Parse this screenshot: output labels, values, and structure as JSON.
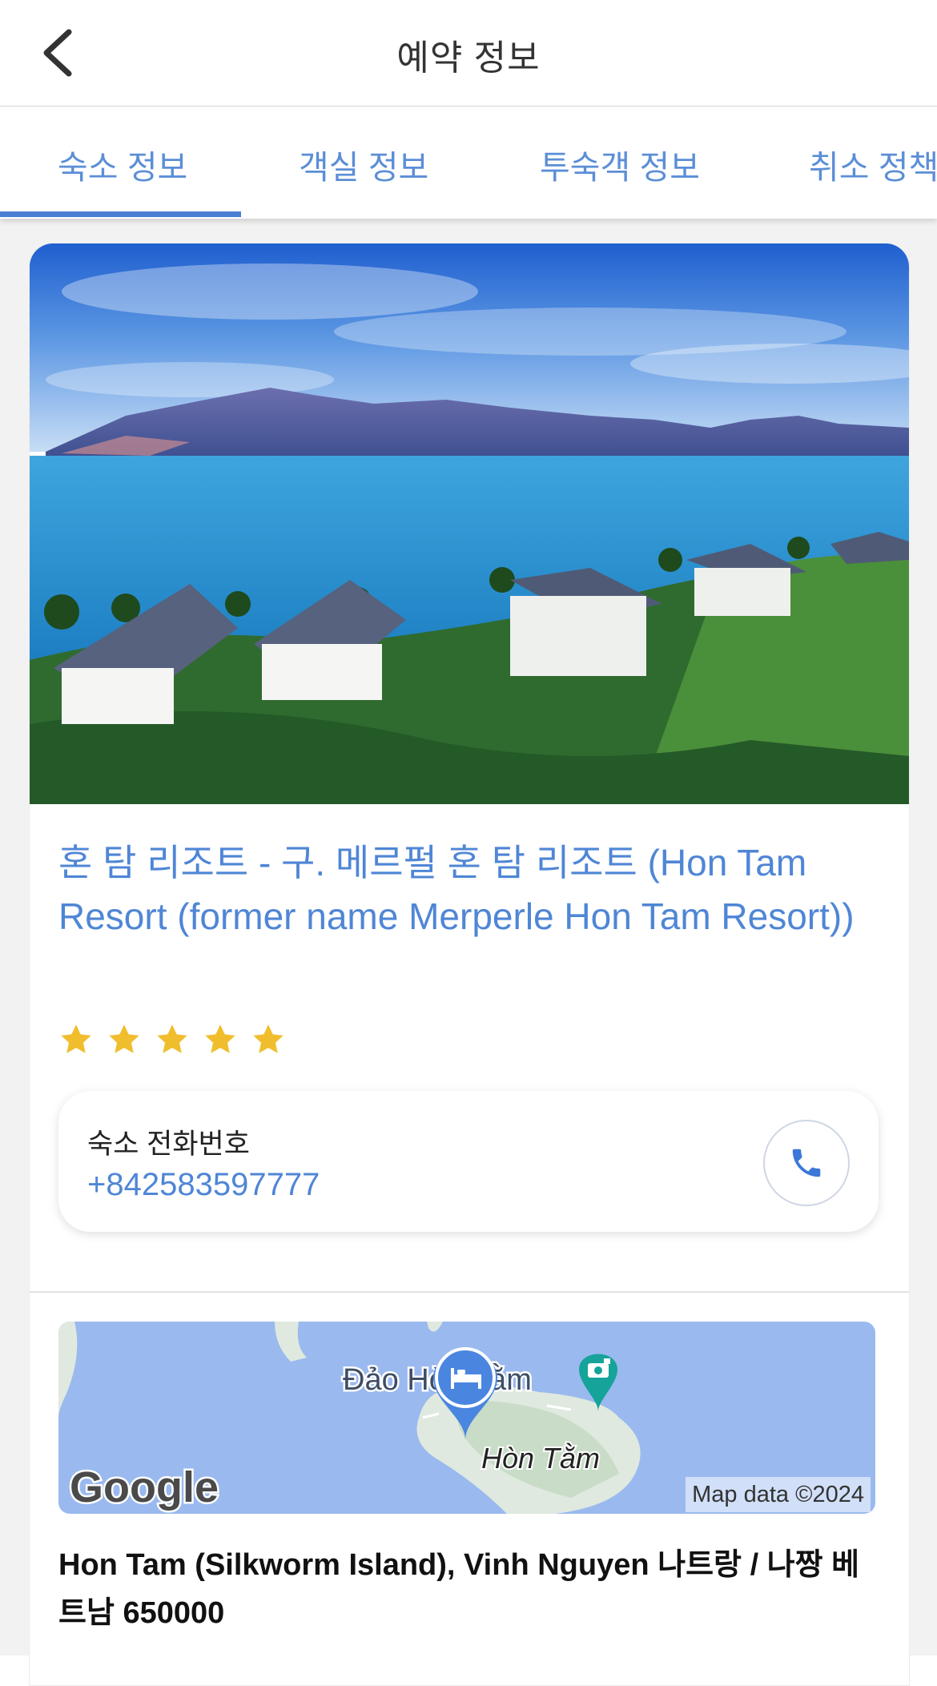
{
  "header": {
    "title": "예약 정보",
    "back_icon": "chevron-left-icon"
  },
  "tabs": [
    {
      "label": "숙소 정보",
      "active": true
    },
    {
      "label": "객실 정보",
      "active": false
    },
    {
      "label": "투숙객 정보",
      "active": false
    },
    {
      "label": "취소 정책",
      "active": false
    }
  ],
  "hotel": {
    "name": "혼 탐 리조트 - 구. 메르펄 혼 탐 리조트 (Hon Tam Resort (former name Merperle Hon Tam Resort))",
    "star_rating": 5,
    "phone_label": "숙소 전화번호",
    "phone_number": "+842583597777",
    "address": "Hon Tam (Silkworm Island), Vinh Nguyen 나트랑 / 나짱 베트남 650000"
  },
  "map": {
    "place_label_1": "Đảo Hòn Tằm",
    "place_label_2": "Hòn Tằm",
    "logo_text": "Google",
    "credit": "Map data ©2024",
    "pin_icon": "bed-pin-icon",
    "poi_icon": "camera-pin-icon"
  },
  "colors": {
    "accent": "#4f86d6",
    "tab_indicator": "#4a80d4",
    "star": "#f0be2d",
    "water": "#9ab9ef",
    "land": "#dfe9df"
  }
}
